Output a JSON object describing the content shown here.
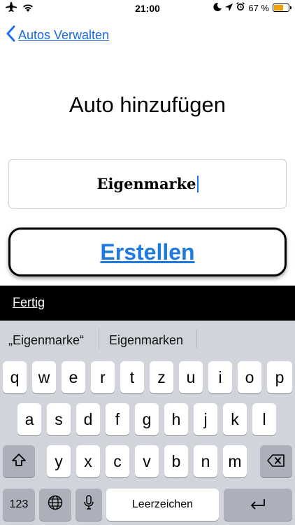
{
  "status_bar": {
    "time": "21:00",
    "battery_percent": "67 %",
    "battery_level": 0.67,
    "left_icons": [
      "airplane-icon",
      "wifi-icon"
    ],
    "right_icons": [
      "moon-icon",
      "location-arrow-icon",
      "alarm-icon",
      "battery-icon"
    ]
  },
  "nav": {
    "back_label": "Autos Verwalten"
  },
  "page": {
    "title": "Auto hinzufügen",
    "name_value": "Eigenmarke",
    "create_label": "Erstellen"
  },
  "toolbar": {
    "done_label": "Fertig"
  },
  "keyboard": {
    "suggestions": [
      "„Eigenmarke“",
      "Eigenmarken"
    ],
    "row1": [
      "q",
      "w",
      "e",
      "r",
      "t",
      "z",
      "u",
      "i",
      "o",
      "p"
    ],
    "row2": [
      "a",
      "s",
      "d",
      "f",
      "g",
      "h",
      "j",
      "k",
      "l"
    ],
    "row3": [
      "y",
      "x",
      "c",
      "v",
      "b",
      "n",
      "m"
    ],
    "numbers_label": "123",
    "space_label": "Leerzeichen",
    "special_icons": [
      "shift-icon",
      "backspace-icon",
      "globe-icon",
      "microphone-icon",
      "return-icon"
    ]
  }
}
